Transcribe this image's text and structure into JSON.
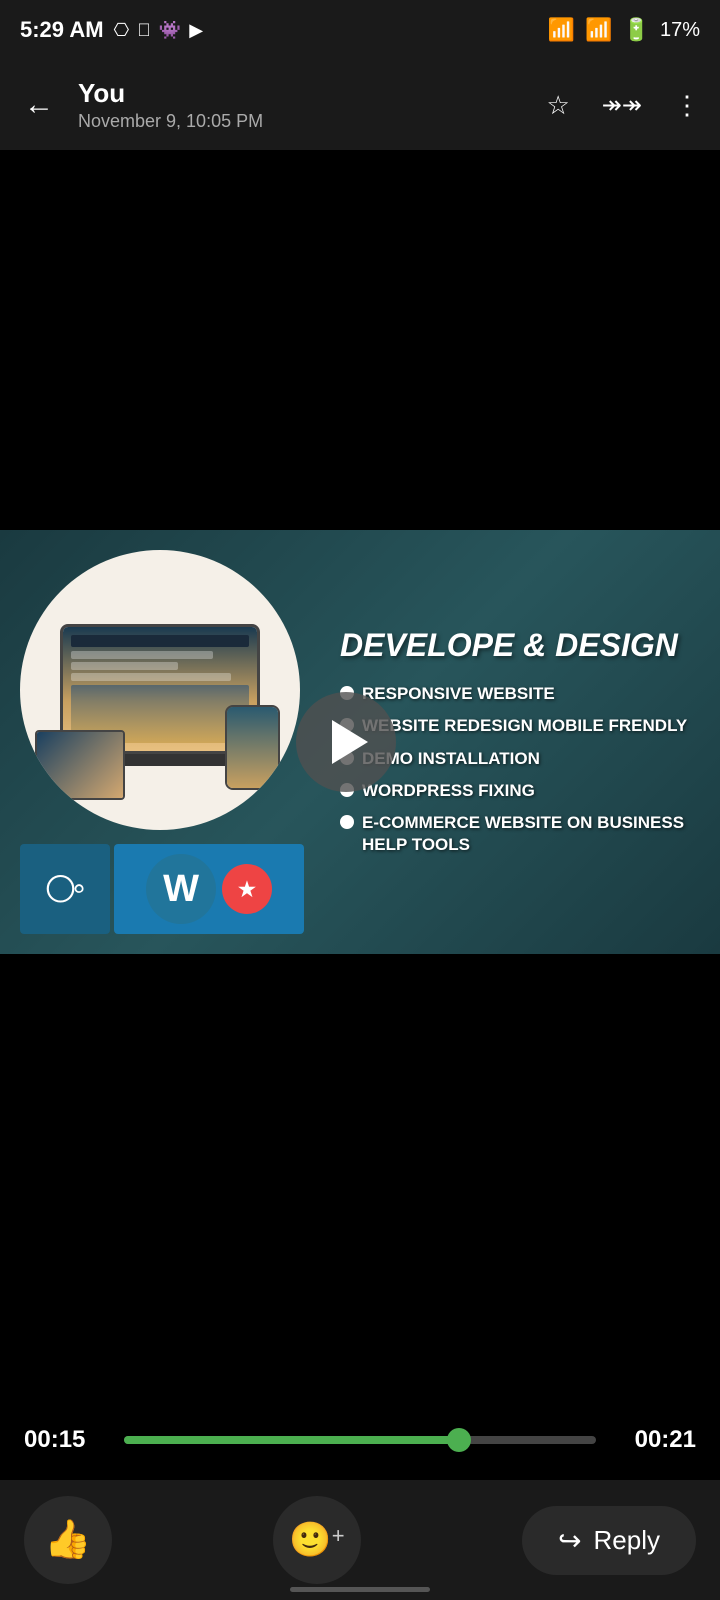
{
  "statusBar": {
    "time": "5:29 AM",
    "batteryPercent": "17%",
    "icons": [
      "notification",
      "facebook",
      "game",
      "youtube"
    ]
  },
  "toolbar": {
    "title": "You",
    "subtitle": "November 9, 10:05 PM",
    "backLabel": "←",
    "starLabel": "☆",
    "forwardLabel": "↠",
    "moreLabel": "⋮"
  },
  "video": {
    "title": "DEVELOPE & DESIGN",
    "services": [
      "RESPONSIVE WEBSITE",
      "WEBSITE REDESIGN MOBILE FRENDLY",
      "DEMO INSTALLATION",
      "WORDPRESS FIXING",
      "E-COMMERCE WEBSITE ON BUSINESS HELP TOOLS"
    ]
  },
  "player": {
    "currentTime": "00:15",
    "totalTime": "00:21",
    "progressPercent": 71
  },
  "actions": {
    "thumbsUp": "👍",
    "emojiAdd": "🙂+",
    "replyLabel": "Reply",
    "replyIcon": "↩"
  }
}
